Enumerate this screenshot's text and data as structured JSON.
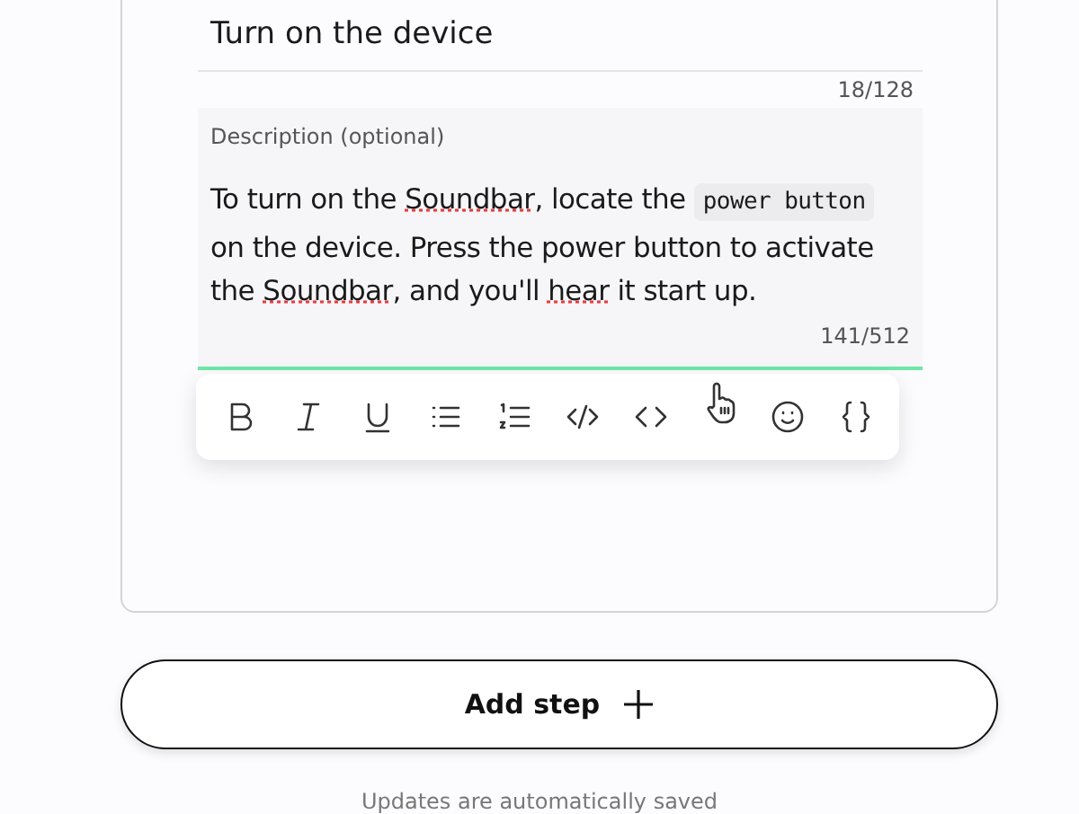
{
  "step": {
    "title": "Turn on the device",
    "title_counter": "18/128",
    "description_label": "Description (optional)",
    "description": [
      {
        "kind": "text",
        "text": "To turn on the "
      },
      {
        "kind": "misspelled",
        "text": "Soundbar"
      },
      {
        "kind": "text",
        "text": ", locate the "
      },
      {
        "kind": "code",
        "text": "power button"
      },
      {
        "kind": "text",
        "text": " on the device. Press the power button to activate the "
      },
      {
        "kind": "misspelled",
        "text": "Soundbar"
      },
      {
        "kind": "text",
        "text": ", and you'll "
      },
      {
        "kind": "misspelled",
        "text": "hear"
      },
      {
        "kind": "text",
        "text": " it start up."
      }
    ],
    "description_counter": "141/512",
    "focused": true
  },
  "toolbar": [
    {
      "kind": "bold"
    },
    {
      "kind": "italic"
    },
    {
      "kind": "underline"
    },
    {
      "kind": "bullets"
    },
    {
      "kind": "numbered"
    },
    {
      "kind": "code-block"
    },
    {
      "kind": "code-inline"
    },
    {
      "kind": "pointer"
    },
    {
      "kind": "emoji"
    },
    {
      "kind": "braces"
    }
  ],
  "add_step": "Add step",
  "footer": "Updates are automatically saved"
}
